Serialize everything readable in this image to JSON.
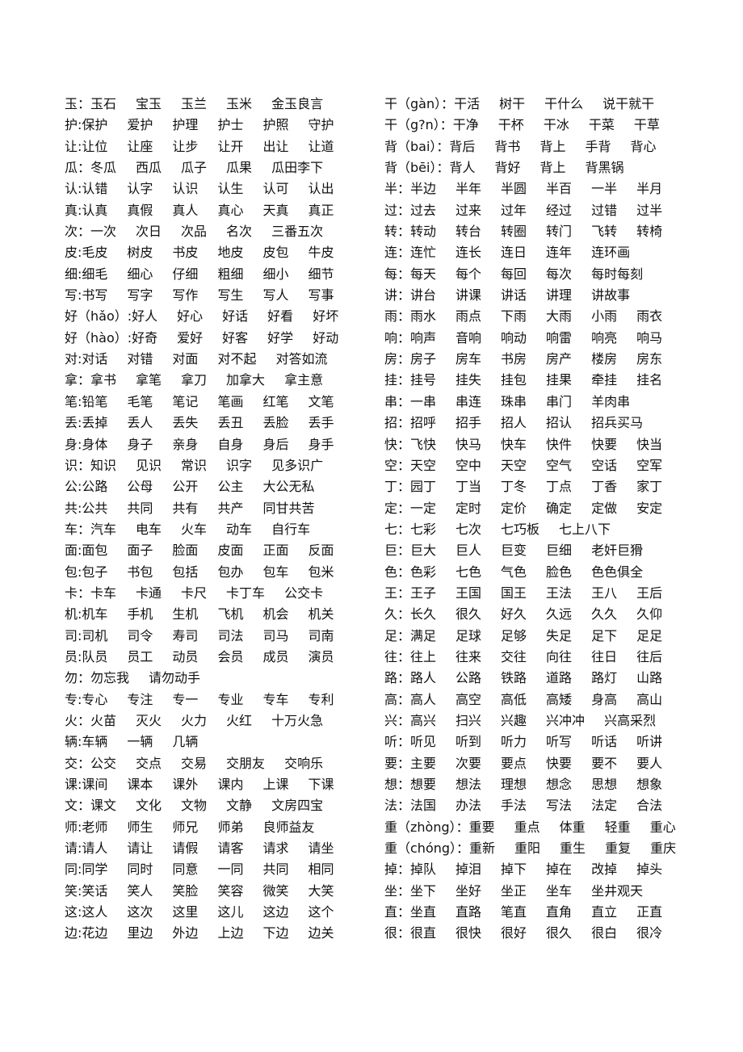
{
  "left": [
    [
      "玉：玉石",
      "宝玉",
      "玉兰",
      "玉米",
      "金玉良言"
    ],
    [
      "护:保护",
      "爱护",
      "护理",
      "护士",
      "护照",
      "守护"
    ],
    [
      "让:让位",
      "让座",
      "让步",
      "让开",
      "出让",
      "让道"
    ],
    [
      "瓜：冬瓜",
      "西瓜",
      "瓜子",
      "瓜果",
      "瓜田李下"
    ],
    [
      "认:认错",
      "认字",
      "认识",
      "认生",
      "认可",
      "认出"
    ],
    [
      "真:认真",
      "真假",
      "真人",
      "真心",
      "天真",
      "真正"
    ],
    [
      "次：一次",
      "次日",
      "次品",
      "名次",
      "三番五次"
    ],
    [
      "皮:毛皮",
      "树皮",
      "书皮",
      "地皮",
      "皮包",
      "牛皮"
    ],
    [
      "细:细毛",
      "细心",
      "仔细",
      "粗细",
      "细小",
      "细节"
    ],
    [
      "写:书写",
      "写字",
      "写作",
      "写生",
      "写人",
      "写事"
    ],
    [
      "好（hǎo）:好人",
      "好心",
      "好话",
      "好看",
      "好坏"
    ],
    [
      "好（hào）:好奇",
      "爱好",
      "好客",
      "好学",
      "好动"
    ],
    [
      "对:对话",
      "对错",
      "对面",
      "对不起",
      "对答如流"
    ],
    [
      "拿：拿书",
      "拿笔",
      "拿刀",
      "加拿大",
      "拿主意"
    ],
    [
      "笔:铅笔",
      "毛笔",
      "笔记",
      "笔画",
      "红笔",
      "文笔"
    ],
    [
      "丢:丢掉",
      "丢人",
      "丢失",
      "丢丑",
      "丢脸",
      "丢手"
    ],
    [
      "身:身体",
      "身子",
      "亲身",
      "自身",
      "身后",
      "身手"
    ],
    [
      "识：知识",
      "见识",
      "常识",
      "识字",
      "见多识广"
    ],
    [
      "公:公路",
      "公母",
      "公开",
      "公主",
      "大公无私"
    ],
    [
      "共:公共",
      "共同",
      "共有",
      "共产",
      "同甘共苦"
    ],
    [
      "车：汽车",
      "电车",
      "火车",
      "动车",
      "自行车"
    ],
    [
      "面:面包",
      "面子",
      "脸面",
      "皮面",
      "正面",
      "反面"
    ],
    [
      "包:包子",
      "书包",
      "包括",
      "包办",
      "包车",
      "包米"
    ],
    [
      "卡：卡车",
      "卡通",
      "卡尺",
      "卡丁车",
      "公交卡"
    ],
    [
      "机:机车",
      "手机",
      "生机",
      "飞机",
      "机会",
      "机关"
    ],
    [
      "司:司机",
      "司令",
      "寿司",
      "司法",
      "司马",
      "司南"
    ],
    [
      "员:队员",
      "员工",
      "动员",
      "会员",
      "成员",
      "演员"
    ],
    [
      "勿：勿忘我",
      "请勿动手"
    ],
    [
      "专:专心",
      "专注",
      "专一",
      "专业",
      "专车",
      "专利"
    ],
    [
      "火：火苗",
      "灭火",
      "火力",
      "火红",
      "十万火急"
    ],
    [
      "辆:车辆",
      "一辆",
      "几辆"
    ],
    [
      "交：公交",
      "交点",
      "交易",
      "交朋友",
      "交响乐"
    ],
    [
      "课:课间",
      "课本",
      "课外",
      "课内",
      "上课",
      "下课"
    ],
    [
      "文：课文",
      "文化",
      "文物",
      "文静",
      "文房四宝"
    ],
    [
      "师:老师",
      "师生",
      "师兄",
      "师弟",
      "良师益友"
    ],
    [
      "请:请人",
      "请让",
      "请假",
      "请客",
      "请求",
      "请坐"
    ],
    [
      "同:同学",
      "同时",
      "同意",
      "一同",
      "共同",
      "相同"
    ],
    [
      "笑:笑话",
      "笑人",
      "笑脸",
      "笑容",
      "微笑",
      "大笑"
    ],
    [
      "这:这人",
      "这次",
      "这里",
      "这儿",
      "这边",
      "这个"
    ],
    [
      "边:花边",
      "里边",
      "外边",
      "上边",
      "下边",
      "边关"
    ]
  ],
  "right": [
    [
      "干（gàn）：干活",
      "树干",
      "干什么",
      "说干就干"
    ],
    [
      "干（g?n）：干净",
      "干杯",
      "干冰",
      "干菜",
      "干草"
    ],
    [
      "背（bai）：背后",
      "背书",
      "背上",
      "手背",
      "背心"
    ],
    [
      "背（bēi）：背人",
      "背好",
      "背上",
      "背黑锅"
    ],
    [
      "半：半边",
      "半年",
      "半圆",
      "半百",
      "一半",
      "半月"
    ],
    [
      "过：过去",
      "过来",
      "过年",
      "经过",
      "过错",
      "过半"
    ],
    [
      "转：转动",
      "转台",
      "转圈",
      "转门",
      "飞转",
      "转椅"
    ],
    [
      "连：连忙",
      "连长",
      "连日",
      "连年",
      "连环画"
    ],
    [
      "每：每天",
      "每个",
      "每回",
      "每次",
      "每时每刻"
    ],
    [
      "讲：讲台",
      "讲课",
      "讲话",
      "讲理",
      "讲故事"
    ],
    [
      "雨：雨水",
      "雨点",
      "下雨",
      "大雨",
      "小雨",
      "雨衣"
    ],
    [
      "响：响声",
      "音响",
      "响动",
      "响雷",
      "响亮",
      "响马"
    ],
    [
      "房：房子",
      "房车",
      "书房",
      "房产",
      "楼房",
      "房东"
    ],
    [
      "挂：挂号",
      "挂失",
      "挂包",
      "挂果",
      "牵挂",
      "挂名"
    ],
    [
      "串：一串",
      "串连",
      "珠串",
      "串门",
      "羊肉串"
    ],
    [
      "招：招呼",
      "招手",
      "招人",
      "招认",
      "招兵买马"
    ],
    [
      "快：飞快",
      "快马",
      "快车",
      "快件",
      "快要",
      "快当"
    ],
    [
      "空：天空",
      "空中",
      "天空",
      "空气",
      "空话",
      "空军"
    ],
    [
      "丁：园丁",
      "丁当",
      "丁冬",
      "丁点",
      "丁香",
      "家丁"
    ],
    [
      "定：一定",
      "定时",
      "定价",
      "确定",
      "定做",
      "安定"
    ],
    [
      "七：七彩",
      "七次",
      "七巧板",
      "七上八下"
    ],
    [
      "巨：巨大",
      "巨人",
      "巨变",
      "巨细",
      "老奸巨猾"
    ],
    [
      "色：色彩",
      "七色",
      "气色",
      "脸色",
      "色色俱全"
    ],
    [
      "王：王子",
      "王国",
      "国王",
      "王法",
      "王八",
      "王后"
    ],
    [
      "久：长久",
      "很久",
      "好久",
      "久远",
      "久久",
      "久仰"
    ],
    [
      "足：满足",
      "足球",
      "足够",
      "失足",
      "足下",
      "足足"
    ],
    [
      "往：往上",
      "往来",
      "交往",
      "向往",
      "往日",
      "往后"
    ],
    [
      "路：路人",
      "公路",
      "铁路",
      "道路",
      "路灯",
      "山路"
    ],
    [
      "高：高人",
      "高空",
      "高低",
      "高矮",
      "身高",
      "高山"
    ],
    [
      "兴：高兴",
      "扫兴",
      "兴趣",
      "兴冲冲",
      "兴高采烈"
    ],
    [
      "听：听见",
      "听到",
      "听力",
      "听写",
      "听话",
      "听讲"
    ],
    [
      "要：主要",
      "次要",
      "要点",
      "快要",
      "要不",
      "要人"
    ],
    [
      "想：想要",
      "想法",
      "理想",
      "想念",
      "思想",
      "想象"
    ],
    [
      "法：法国",
      "办法",
      "手法",
      "写法",
      "法定",
      "合法"
    ],
    [
      "重（zhòng）：重要",
      "重点",
      "体重",
      "轻重",
      "重心"
    ],
    [
      "重（chóng）：重新",
      "重阳",
      "重生",
      "重复",
      "重庆"
    ],
    [
      "掉：掉队",
      "掉泪",
      "掉下",
      "掉在",
      "改掉",
      "掉头"
    ],
    [
      "坐：坐下",
      "坐好",
      "坐正",
      "坐车",
      "坐井观天"
    ],
    [
      "直：坐直",
      "直路",
      "笔直",
      "直角",
      "直立",
      "正直"
    ],
    [
      "很：很直",
      "很快",
      "很好",
      "很久",
      "很白",
      "很冷"
    ]
  ]
}
